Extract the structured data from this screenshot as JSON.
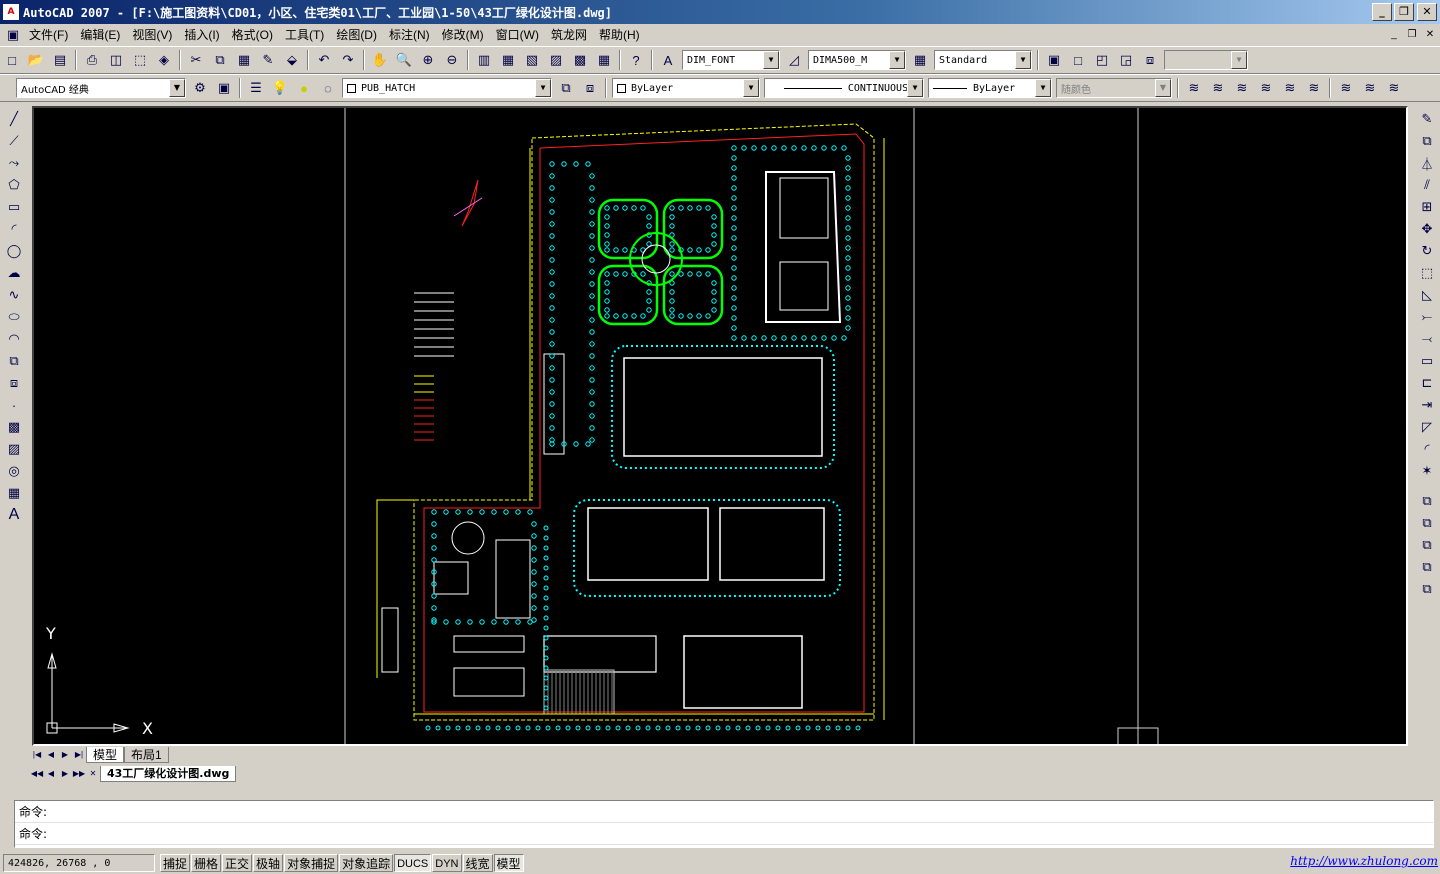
{
  "window": {
    "title": "AutoCAD 2007 - [F:\\施工图资料\\CD01，小区、住宅类01\\工厂、工业园\\1-50\\43工厂绿化设计图.dwg]",
    "app_icon": "A"
  },
  "menu": [
    "文件(F)",
    "编辑(E)",
    "视图(V)",
    "插入(I)",
    "格式(O)",
    "工具(T)",
    "绘图(D)",
    "标注(N)",
    "修改(M)",
    "窗口(W)",
    "筑龙网",
    "帮助(H)"
  ],
  "styles_toolbar": {
    "text_style": "DIM_FONT",
    "dim_style": "DIMA500_M",
    "table_style": "Standard",
    "extra": ""
  },
  "workspace": "AutoCAD 经典",
  "layers_toolbar": {
    "current_layer": "PUB_HATCH",
    "color": "ByLayer",
    "linetype": "CONTINUOUS",
    "lineweight": "ByLayer",
    "plot_style": "随颜色"
  },
  "tabs": {
    "model": "模型",
    "layout1": "布局1",
    "document": "43工厂绿化设计图.dwg"
  },
  "ucs": {
    "x_label": "X",
    "y_label": "Y"
  },
  "command_lines": [
    "命令:",
    "命令:"
  ],
  "status": {
    "coordinates": "424826, 26768 , 0",
    "toggles": [
      {
        "label": "捕捉",
        "on": false
      },
      {
        "label": "栅格",
        "on": false
      },
      {
        "label": "正交",
        "on": false
      },
      {
        "label": "极轴",
        "on": false
      },
      {
        "label": "对象捕捉",
        "on": false
      },
      {
        "label": "对象追踪",
        "on": false
      },
      {
        "label": "DUCS",
        "on": true
      },
      {
        "label": "DYN",
        "on": false
      },
      {
        "label": "线宽",
        "on": false
      },
      {
        "label": "模型",
        "on": true
      }
    ],
    "link": "http://www.zhulong.com"
  },
  "colors": {
    "canvas": "#000000",
    "hedge": "#00ff00",
    "tree": "#00ffff",
    "road": "#ff2020",
    "building": "#ffffff",
    "dimension": "#ffff00",
    "titlebar": "#0a246a"
  }
}
